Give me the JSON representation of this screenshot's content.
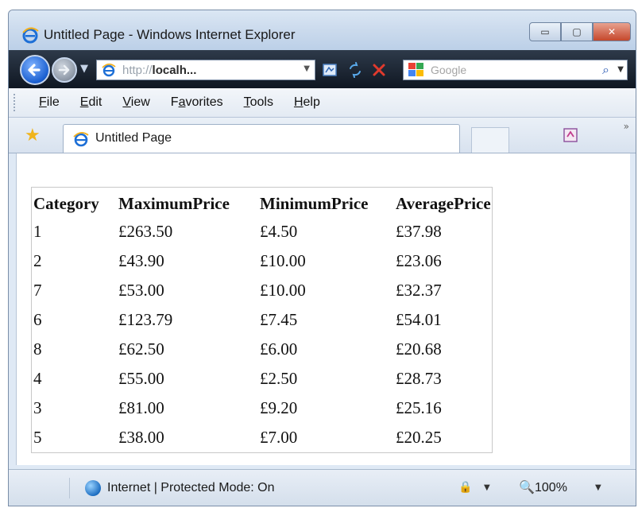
{
  "window": {
    "title": "Untitled Page - Windows Internet Explorer",
    "minimize_glyph": "▭",
    "maximize_glyph": "▢",
    "close_glyph": "✕"
  },
  "address": {
    "url_prefix": "http://",
    "url_host": "localh...",
    "url_dropdown": "▼",
    "search_placeholder": "Google",
    "search_go_glyph": "⌕",
    "search_dropdown": "▼"
  },
  "menu": {
    "items": [
      {
        "label_u": "F",
        "label_rest": "ile"
      },
      {
        "label_u": "E",
        "label_rest": "dit"
      },
      {
        "label_u": "V",
        "label_rest": "iew"
      },
      {
        "label_pre": "F",
        "label_u": "a",
        "label_rest": "vorites"
      },
      {
        "label_u": "T",
        "label_rest": "ools"
      },
      {
        "label_u": "H",
        "label_rest": "elp"
      }
    ]
  },
  "tabs": {
    "favorites_glyph": "★",
    "active_tab_label": "Untitled Page",
    "overflow_glyph": "»"
  },
  "table": {
    "headers": [
      "Category",
      "MaximumPrice",
      "MinimumPrice",
      "AveragePrice"
    ],
    "rows": [
      [
        "1",
        "£263.50",
        "£4.50",
        "£37.98"
      ],
      [
        "2",
        "£43.90",
        "£10.00",
        "£23.06"
      ],
      [
        "7",
        "£53.00",
        "£10.00",
        "£32.37"
      ],
      [
        "6",
        "£123.79",
        "£7.45",
        "£54.01"
      ],
      [
        "8",
        "£62.50",
        "£6.00",
        "£20.68"
      ],
      [
        "4",
        "£55.00",
        "£2.50",
        "£28.73"
      ],
      [
        "3",
        "£81.00",
        "£9.20",
        "£25.16"
      ],
      [
        "5",
        "£38.00",
        "£7.00",
        "£20.25"
      ]
    ]
  },
  "status": {
    "zone_text": "Internet | Protected Mode: On",
    "zoom_glyph": "🔍",
    "zoom_level": "100%",
    "dropdown_glyph": "▼"
  },
  "colors": {
    "close_button": "#c5482c",
    "ie_logo": "#1d6fd6",
    "favorites_star": "#f0b41b"
  }
}
